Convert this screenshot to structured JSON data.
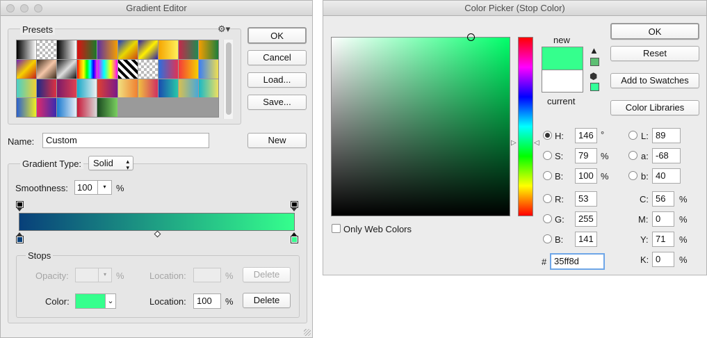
{
  "gradient_editor": {
    "title": "Gradient Editor",
    "presets_label": "Presets",
    "gear_icon": "gear-icon",
    "buttons": {
      "ok": "OK",
      "cancel": "Cancel",
      "load": "Load...",
      "save": "Save...",
      "new": "New"
    },
    "name_label": "Name:",
    "name_value": "Custom",
    "gradient_type_label": "Gradient Type:",
    "gradient_type_value": "Solid",
    "smoothness_label": "Smoothness:",
    "smoothness_value": "100",
    "percent": "%",
    "gradient": {
      "start_color": "#08407a",
      "end_color": "#35ff8d"
    },
    "stops": {
      "label": "Stops",
      "opacity_label": "Opacity:",
      "opacity_value": "",
      "location_label": "Location:",
      "location_top_value": "",
      "delete_label": "Delete",
      "color_label": "Color:",
      "color_value": "#35ff8d",
      "location_bottom_value": "100"
    },
    "presets": [
      "linear-gradient(90deg,#000,#fff)",
      "repeating-conic-gradient(#bbb 0 25%,#fff 0 50%) 0 0/8px 8px",
      "linear-gradient(90deg,#000,#fff)",
      "linear-gradient(90deg,#d11,#1a7a2a)",
      "linear-gradient(90deg,#5a2ea6,#f5a000)",
      "linear-gradient(135deg,#1836c8,#e8d800,#c41)",
      "linear-gradient(135deg,#2a1da8,#ffef00,#2a1da8)",
      "linear-gradient(90deg,#f5a400,#fff05a)",
      "linear-gradient(90deg,#c6284a,#1f8a52)",
      "linear-gradient(90deg,#f59e00,#1c7e3c)",
      "linear-gradient(135deg,#6c1eb4,#f7d000,#c21b1b)",
      "linear-gradient(135deg,#3b2a1a,#f4c6a8,#3b2a1a)",
      "linear-gradient(135deg,#111,#ddd,#111)",
      "linear-gradient(90deg,red,orange,yellow,lime,cyan,blue,magenta)",
      "linear-gradient(90deg,#f0f,#0ff,#ff0,#f0f)",
      "repeating-linear-gradient(45deg,#000 0 4px,#fff 4px 8px)",
      "repeating-conic-gradient(#bbb 0 25%,#fff 0 50%) 0 0/8px 8px",
      "linear-gradient(90deg,#2a70e0,#e03355)",
      "linear-gradient(90deg,#f53a3a,#f5d000)",
      "linear-gradient(90deg,#3a7ef5,#f0e050)",
      "linear-gradient(90deg,#4ad0c8,#f0d030)",
      "linear-gradient(90deg,#1a2a8a,#e03040)",
      "linear-gradient(90deg,#7a1a6a,#e04050)",
      "linear-gradient(90deg,#18a8c8,#f0f0f0)",
      "linear-gradient(90deg,#e04030,#7a1a8a)",
      "linear-gradient(90deg,#f0e080,#f08030)",
      "linear-gradient(90deg,#f0c040,#d03060)",
      "linear-gradient(90deg,#1a4ab0,#28c8a8)",
      "linear-gradient(90deg,#d8c050,#4aa8d8)",
      "linear-gradient(90deg,#18b8c8,#f0e060)",
      "linear-gradient(90deg,#2a60d0,#f0f020)",
      "linear-gradient(90deg,#e02a6a,#3a2ab0)",
      "linear-gradient(90deg,#1a7ad0,#e8f0f8)",
      "linear-gradient(90deg,#c81a3a,#d8d8d8)",
      "linear-gradient(90deg,#1a4a20,#7ad060)"
    ]
  },
  "color_picker": {
    "title": "Color Picker (Stop Color)",
    "new_label": "new",
    "current_label": "current",
    "new_color": "#35ff8d",
    "current_color": "#ffffff",
    "hue_color": "#00ff6a",
    "warning_icon": "warning-triangle-icon",
    "cube_icon": "web-safe-cube-icon",
    "gamut_swatch": "#5dbf73",
    "websafe_swatch": "#33ff99",
    "buttons": {
      "ok": "OK",
      "reset": "Reset",
      "add_swatches": "Add to Swatches",
      "libraries": "Color Libraries"
    },
    "only_web_colors": "Only Web Colors",
    "hsb": {
      "h_label": "H:",
      "h_value": "146",
      "h_unit": "°",
      "s_label": "S:",
      "s_value": "79",
      "s_unit": "%",
      "b_label": "B:",
      "b_value": "100",
      "b_unit": "%"
    },
    "rgb": {
      "r_label": "R:",
      "r_value": "53",
      "g_label": "G:",
      "g_value": "255",
      "b_label": "B:",
      "b_value": "141"
    },
    "lab": {
      "l_label": "L:",
      "l_value": "89",
      "a_label": "a:",
      "a_value": "-68",
      "b_label": "b:",
      "b_value": "40"
    },
    "cmyk": {
      "c_label": "C:",
      "c_value": "56",
      "m_label": "M:",
      "m_value": "0",
      "y_label": "Y:",
      "y_value": "71",
      "k_label": "K:",
      "k_value": "0",
      "unit": "%"
    },
    "hex_label": "#",
    "hex_value": "35ff8d"
  }
}
